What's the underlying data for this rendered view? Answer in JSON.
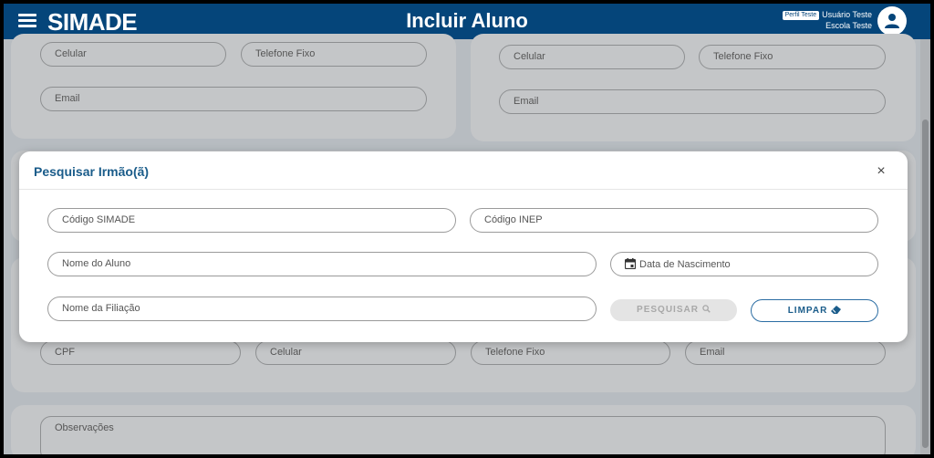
{
  "header": {
    "logo": "SIMADE",
    "title": "Incluir Aluno",
    "profile_badge": "Perfil Teste",
    "user_name": "Usuário Teste",
    "school_name": "Escola Teste"
  },
  "background_form": {
    "left_card": {
      "celular": "Celular",
      "telefone_fixo": "Telefone Fixo",
      "email": "Email"
    },
    "right_card": {
      "celular": "Celular",
      "telefone_fixo": "Telefone Fixo",
      "email": "Email"
    },
    "lower_row": {
      "cpf": "CPF",
      "celular": "Celular",
      "telefone_fixo": "Telefone Fixo",
      "email": "Email"
    },
    "observacoes": "Observações"
  },
  "modal": {
    "title": "Pesquisar Irmão(ã)",
    "close_symbol": "×",
    "fields": {
      "codigo_simade": "Código SIMADE",
      "codigo_inep": "Código INEP",
      "nome_aluno": "Nome do Aluno",
      "data_nascimento": "Data de Nascimento",
      "nome_filiacao": "Nome da Filiação"
    },
    "buttons": {
      "pesquisar": "PESQUISAR",
      "limpar": "LIMPAR"
    }
  },
  "icons": {
    "menu": "hamburger-menu-icon",
    "avatar": "user-icon",
    "calendar": "calendar-icon",
    "search": "search-icon",
    "eraser": "eraser-icon"
  },
  "colors": {
    "header": "#05457a",
    "accent": "#1a5c8a",
    "overlay": "#b7bcc1"
  }
}
